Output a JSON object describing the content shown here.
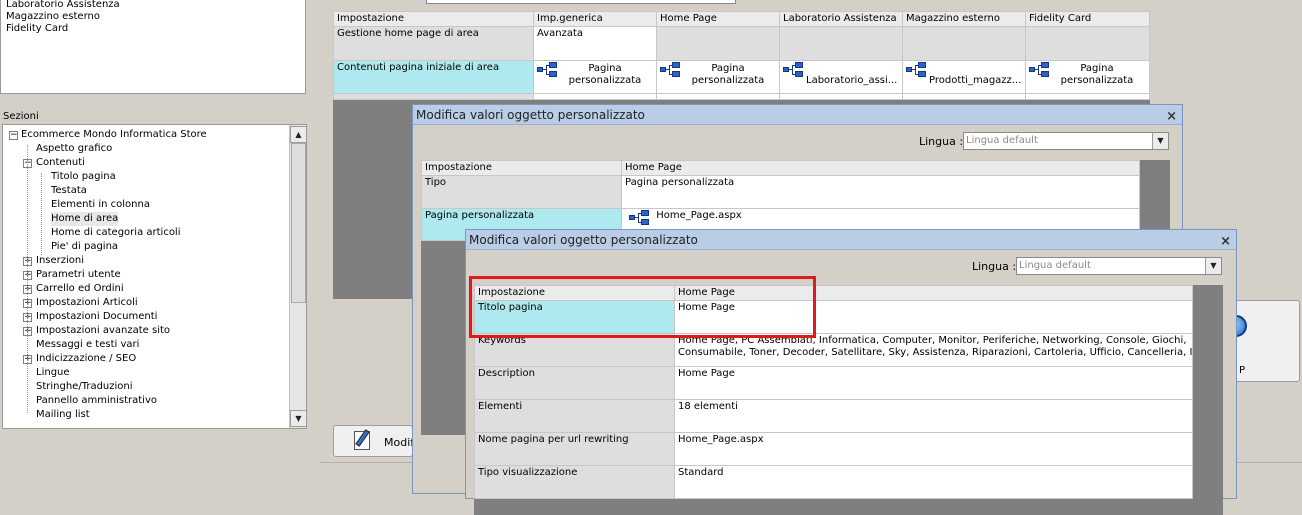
{
  "top_list": {
    "items": [
      "Laboratorio Assistenza",
      "Magazzino esterno",
      "Fidelity Card"
    ]
  },
  "sezioni": {
    "label": "Sezioni",
    "tree": [
      {
        "label": "Ecommerce Mondo Informatica Store",
        "level": 0,
        "toggle": "−"
      },
      {
        "label": "Aspetto grafico",
        "level": 1
      },
      {
        "label": "Contenuti",
        "level": 1,
        "toggle": "−"
      },
      {
        "label": "Titolo pagina",
        "level": 2
      },
      {
        "label": "Testata",
        "level": 2
      },
      {
        "label": "Elementi in colonna",
        "level": 2
      },
      {
        "label": "Home di area",
        "level": 2,
        "selected": true
      },
      {
        "label": "Home di categoria articoli",
        "level": 2
      },
      {
        "label": "Pie' di pagina",
        "level": 2
      },
      {
        "label": "Inserzioni",
        "level": 1,
        "toggle": "+"
      },
      {
        "label": "Parametri utente",
        "level": 1,
        "toggle": "+"
      },
      {
        "label": "Carrello ed Ordini",
        "level": 1,
        "toggle": "+"
      },
      {
        "label": "Impostazioni Articoli",
        "level": 1,
        "toggle": "+"
      },
      {
        "label": "Impostazioni Documenti",
        "level": 1,
        "toggle": "+"
      },
      {
        "label": "Impostazioni avanzate sito",
        "level": 1,
        "toggle": "+"
      },
      {
        "label": "Messaggi e testi vari",
        "level": 1
      },
      {
        "label": "Indicizzazione / SEO",
        "level": 1,
        "toggle": "+"
      },
      {
        "label": "Lingue",
        "level": 1
      },
      {
        "label": "Stringhe/Traduzioni",
        "level": 1
      },
      {
        "label": "Pannello amministrativo",
        "level": 1
      },
      {
        "label": "Mailing list",
        "level": 1
      }
    ]
  },
  "main_grid": {
    "headers": [
      "Impostazione",
      "Imp.generica",
      "Home Page",
      "Laboratorio Assistenza",
      "Magazzino esterno",
      "Fidelity Card"
    ],
    "row1": {
      "label": "Gestione home page di area",
      "generica": "Avanzata"
    },
    "row2": {
      "label": "Contenuti pagina iniziale di area",
      "generica_l1": "Pagina",
      "generica_l2": "personalizzata",
      "home_l1": "Pagina",
      "home_l2": "personalizzata",
      "lab": "Laboratorio_assi...",
      "mag": "Prodotti_magazz...",
      "fid_l1": "Pagina",
      "fid_l2": "personalizzata"
    }
  },
  "modify_button": {
    "label": "Modifi"
  },
  "right_button": {
    "label": "P"
  },
  "dialog1": {
    "title": "Modifica valori oggetto personalizzato",
    "close": "×",
    "lingua_label": "Lingua :",
    "lingua_value": "Lingua default",
    "headers": [
      "Impostazione",
      "Home Page"
    ],
    "rows": [
      {
        "label": "Tipo",
        "value": "Pagina personalizzata"
      },
      {
        "label": "Pagina personalizzata",
        "value": "Home_Page.aspx"
      }
    ]
  },
  "dialog2": {
    "title": "Modifica valori oggetto personalizzato",
    "close": "×",
    "lingua_label": "Lingua :",
    "lingua_value": "Lingua default",
    "headers": [
      "Impostazione",
      "Home Page"
    ],
    "rows": [
      {
        "label": "Titolo pagina",
        "value": "Home Page"
      },
      {
        "label": "Keywords",
        "value": "Home Page, PC Assemblati, Informatica, Computer, Monitor, Periferiche, Networking, Console, Giochi,",
        "value2": "Consumabile, Toner, Decoder, Satellitare, Sky, Assistenza, Riparazioni, Cartoleria, Ufficio, Cancelleria, I..."
      },
      {
        "label": "Description",
        "value": "Home Page"
      },
      {
        "label": "Elementi",
        "value": "18 elementi"
      },
      {
        "label": "Nome pagina per url rewriting",
        "value": "Home_Page.aspx"
      },
      {
        "label": "Tipo visualizzazione",
        "value": "Standard"
      }
    ]
  },
  "colors": {
    "highlight_row": "#ade9ee",
    "annotation": "#e0191c",
    "dialog_title": "#b9cde6"
  }
}
